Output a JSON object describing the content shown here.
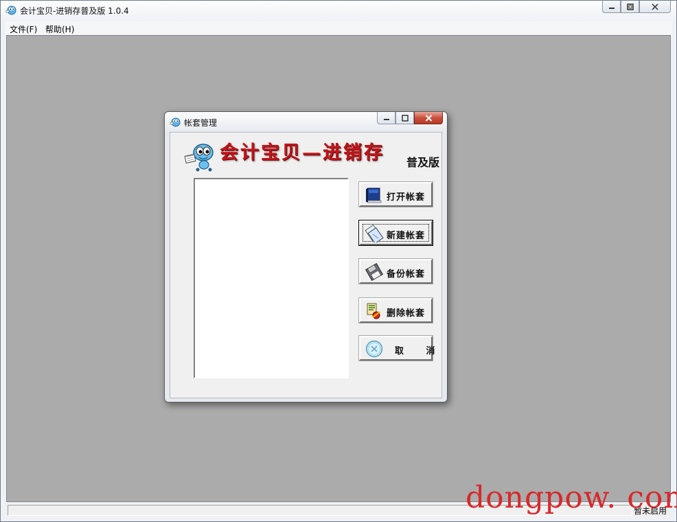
{
  "main_window": {
    "title": "会计宝贝-进销存普及版 1.0.4",
    "menu": [
      {
        "label": "文件(F)"
      },
      {
        "label": "帮助(H)"
      }
    ],
    "status": {
      "text": "暂未启用"
    }
  },
  "dialog": {
    "title": "帐套管理",
    "logo_main": "会计宝贝—进销存",
    "logo_sub": "普及版",
    "buttons": [
      {
        "label": "打开帐套",
        "icon": "book-icon"
      },
      {
        "label": "新建帐套",
        "icon": "new-document-icon"
      },
      {
        "label": "备份帐套",
        "icon": "floppy-disk-icon"
      },
      {
        "label": "删除帐套",
        "icon": "delete-icon"
      },
      {
        "label": "取 消",
        "icon": "cancel-icon"
      }
    ]
  },
  "watermark": "dongpow. com",
  "colors": {
    "logo_red": "#c3151b",
    "client_background": "#ababab",
    "watermark_red": "#d8282a"
  }
}
